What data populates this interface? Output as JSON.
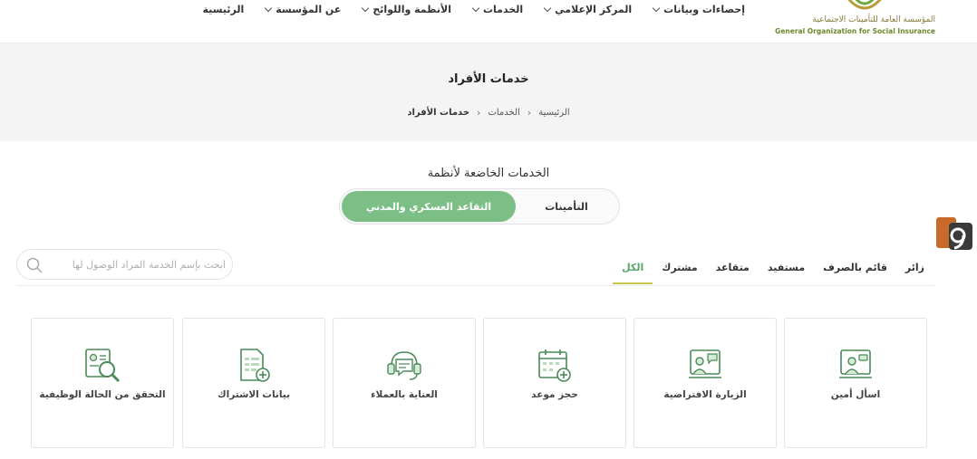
{
  "logo": {
    "ar": "المؤسسة العامة للتأمينات الاجتماعية",
    "en": "General Organization for Social Insurance"
  },
  "nav": [
    {
      "label": "الرئيسية",
      "has_menu": false
    },
    {
      "label": "عن المؤسسة",
      "has_menu": true
    },
    {
      "label": "الأنظمة واللوائح",
      "has_menu": true
    },
    {
      "label": "الخدمات",
      "has_menu": true
    },
    {
      "label": "المركز الإعلامي",
      "has_menu": true
    },
    {
      "label": "إحصاءات وبيانات",
      "has_menu": true
    }
  ],
  "banner": {
    "title": "خدمات الأفراد",
    "breadcrumb": [
      "الرئيسية",
      "الخدمات",
      "خدمات الأفراد"
    ]
  },
  "systems": {
    "title": "الخدمات الخاضعة لأنظمة",
    "option_a": "التأمينات",
    "option_b": "التقاعد العسكري والمدني",
    "selected": "option_b"
  },
  "search": {
    "placeholder": "ابحث بإسم الخدمة المراد الوصول لها"
  },
  "tabs": [
    {
      "label": "الكل",
      "active": true
    },
    {
      "label": "مشترك",
      "active": false
    },
    {
      "label": "متقاعد",
      "active": false
    },
    {
      "label": "مستفيد",
      "active": false
    },
    {
      "label": "قائم بالصرف",
      "active": false
    },
    {
      "label": "زائر",
      "active": false
    }
  ],
  "cards": [
    {
      "label": "اسأل أمين",
      "icon": "agent-icon"
    },
    {
      "label": "الزيارة الافتراضية",
      "icon": "video-call-icon"
    },
    {
      "label": "حجز موعد",
      "icon": "calendar-add-icon"
    },
    {
      "label": "العناية بالعملاء",
      "icon": "customer-care-icon"
    },
    {
      "label": "بيانات الاشتراك",
      "icon": "document-add-icon"
    },
    {
      "label": "التحقق من الحالة الوظيفية",
      "icon": "id-search-icon"
    }
  ],
  "colors": {
    "accent": "#7bbf86",
    "tab_active": "#5aa86a",
    "tab_underline": "#c7c84a"
  }
}
